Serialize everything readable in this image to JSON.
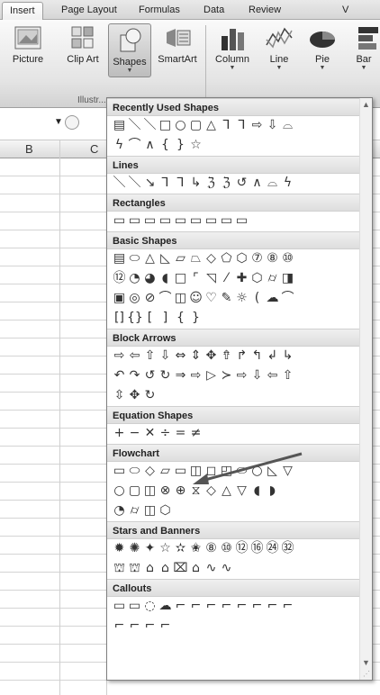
{
  "tabs": [
    "Insert",
    "Page Layout",
    "Formulas",
    "Data",
    "Review",
    "V"
  ],
  "ribbon": {
    "buttons": [
      "Picture",
      "Clip Art",
      "Shapes",
      "SmartArt",
      "Column",
      "Line",
      "Pie",
      "Bar"
    ],
    "group_label": "Illustr..."
  },
  "grid": {
    "columns": [
      "B",
      "C"
    ]
  },
  "gallery": {
    "categories": [
      {
        "title": "Recently Used Shapes",
        "rows": [
          [
            "▤",
            "＼",
            "＼",
            "□",
            "○",
            "▢",
            "△",
            "⅂",
            "⅂",
            "⇨",
            "⇩",
            "⌓"
          ],
          [
            "ϟ",
            "⌒",
            "∧",
            "{",
            "}",
            "☆"
          ]
        ]
      },
      {
        "title": "Lines",
        "rows": [
          [
            "＼",
            "＼",
            "↘",
            "⅂",
            "⅂",
            "↳",
            "ℨ",
            "ℨ",
            "↺",
            "∧",
            "⌓",
            "ϟ"
          ]
        ]
      },
      {
        "title": "Rectangles",
        "rows": [
          [
            "▭",
            "▭",
            "▭",
            "▭",
            "▭",
            "▭",
            "▭",
            "▭",
            "▭"
          ]
        ]
      },
      {
        "title": "Basic Shapes",
        "rows": [
          [
            "▤",
            "⬭",
            "△",
            "◺",
            "▱",
            "⏢",
            "◇",
            "⬠",
            "⬡",
            "⑦",
            "⑧",
            "⑩"
          ],
          [
            "⑫",
            "◔",
            "◕",
            "◖",
            "□",
            "⌜",
            "◹",
            "⁄",
            "✚",
            "⬡",
            "⌭",
            "◨"
          ],
          [
            "▣",
            "◎",
            "⊘",
            "⌒",
            "◫",
            "☺",
            "♡",
            "✎",
            "☼",
            "(",
            "☁",
            "⌒"
          ],
          [
            "[]",
            "{}",
            "[",
            "]",
            "{",
            "}"
          ]
        ]
      },
      {
        "title": "Block Arrows",
        "rows": [
          [
            "⇨",
            "⇦",
            "⇧",
            "⇩",
            "⇔",
            "⇕",
            "✥",
            "⇮",
            "↱",
            "↰",
            "↲",
            "↳"
          ],
          [
            "↶",
            "↷",
            "↺",
            "↻",
            "⇒",
            "⇨",
            "▷",
            "≻",
            "⇨",
            "⇩",
            "⇦",
            "⇧"
          ],
          [
            "⇳",
            "✥",
            "↻"
          ]
        ]
      },
      {
        "title": "Equation Shapes",
        "rows": [
          [
            "+",
            "−",
            "✕",
            "÷",
            "=",
            "≠"
          ]
        ]
      },
      {
        "title": "Flowchart",
        "rows": [
          [
            "▭",
            "⬭",
            "◇",
            "▱",
            "▭",
            "◫",
            "◻",
            "◰",
            "⬭",
            "○",
            "◺",
            "▽"
          ],
          [
            "○",
            "▢",
            "◫",
            "⊗",
            "⊕",
            "⧖",
            "◇",
            "△",
            "▽",
            "◖",
            "◗"
          ],
          [
            "◔",
            "⌭",
            "◫",
            "⬡"
          ]
        ]
      },
      {
        "title": "Stars and Banners",
        "rows": [
          [
            "✹",
            "✺",
            "✦",
            "☆",
            "✫",
            "✬",
            "⑧",
            "⑩",
            "⑫",
            "⑯",
            "㉔",
            "㉜"
          ],
          [
            "⛫",
            "⛫",
            "⌂",
            "⌂",
            "⌧",
            "⌂",
            "∿",
            "∿"
          ]
        ]
      },
      {
        "title": "Callouts",
        "rows": [
          [
            "▭",
            "▭",
            "◌",
            "☁",
            "⌐",
            "⌐",
            "⌐",
            "⌐",
            "⌐",
            "⌐",
            "⌐",
            "⌐"
          ],
          [
            "⌐",
            "⌐",
            "⌐",
            "⌐"
          ]
        ]
      }
    ]
  },
  "colors": {
    "ribbon": "#e4e4e4",
    "header": "#dedede",
    "accent": "#555555"
  }
}
